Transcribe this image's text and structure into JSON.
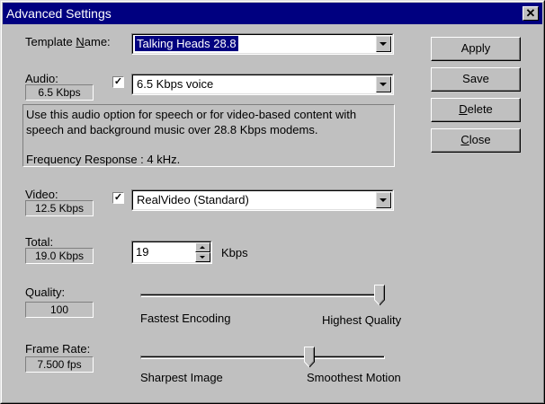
{
  "window": {
    "title": "Advanced Settings",
    "close_icon": "close-icon"
  },
  "template": {
    "label_pre": "Template ",
    "label_accel": "N",
    "label_post": "ame:",
    "value": "Talking Heads 28.8"
  },
  "audio": {
    "label": "Audio:",
    "rate": "6.5 Kbps",
    "enabled": true,
    "codec": "6.5 Kbps voice",
    "description_1": "Use this audio option for speech or for video-based content with",
    "description_2": "speech and background music over 28.8 Kbps modems.",
    "description_3": "Frequency Response : 4 kHz."
  },
  "video": {
    "label": "Video:",
    "rate": "12.5 Kbps",
    "enabled": true,
    "codec": "RealVideo (Standard)"
  },
  "total": {
    "label": "Total:",
    "rate": "19.0 Kbps",
    "value": "19",
    "unit": "Kbps"
  },
  "quality": {
    "label": "Quality:",
    "value": "100",
    "level": 1.0,
    "min_label": "Fastest Encoding",
    "max_label": "Highest Quality"
  },
  "frame_rate": {
    "label": "Frame Rate:",
    "value": "7.500 fps",
    "level": 0.7,
    "min_label": "Sharpest Image",
    "max_label": "Smoothest Motion"
  },
  "buttons": {
    "apply": "Apply",
    "save": "Save",
    "delete_accel": "D",
    "delete_rest": "elete",
    "close_accel": "C",
    "close_rest": "lose"
  },
  "colors": {
    "titlebar": "#000080",
    "face": "#c0c0c0"
  }
}
